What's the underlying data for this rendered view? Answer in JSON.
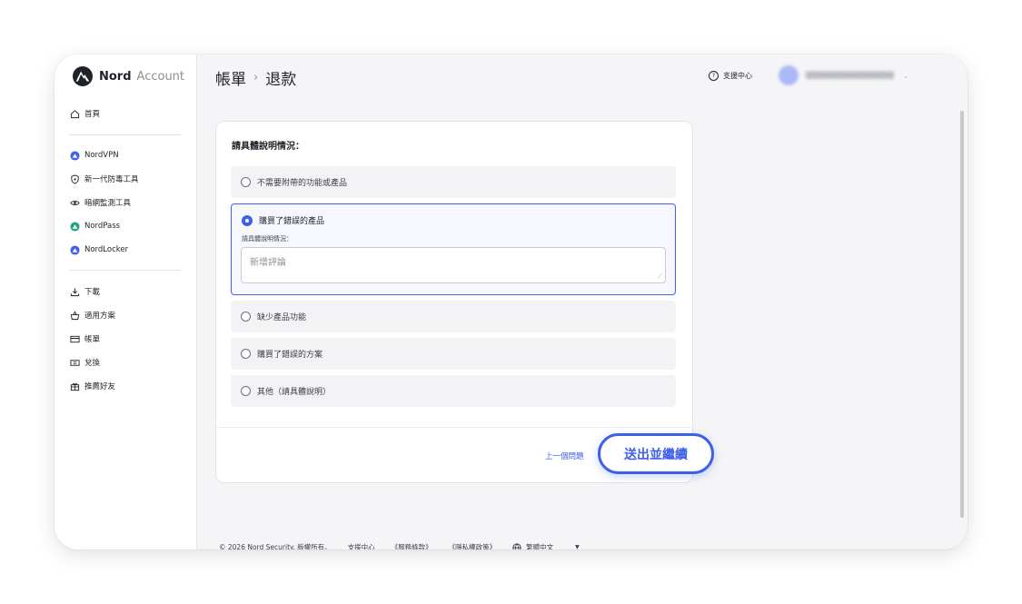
{
  "app": {
    "brand": "Nord",
    "product": "Account"
  },
  "sidebar": {
    "home": "首頁",
    "products": [
      {
        "label": "NordVPN",
        "icon": "nordvpn-icon",
        "color": "#4361ee"
      },
      {
        "label": "新一代防毒工具",
        "icon": "shield-icon"
      },
      {
        "label": "暗網監測工具",
        "icon": "eye-icon"
      },
      {
        "label": "NordPass",
        "icon": "nordpass-icon",
        "color": "#27a38a"
      },
      {
        "label": "NordLocker",
        "icon": "nordlocker-icon",
        "color": "#4361ee"
      }
    ],
    "account": [
      {
        "label": "下載",
        "icon": "download-icon"
      },
      {
        "label": "適用方案",
        "icon": "basket-icon"
      },
      {
        "label": "帳單",
        "icon": "card-icon"
      },
      {
        "label": "兌換",
        "icon": "ticket-icon"
      },
      {
        "label": "推薦好友",
        "icon": "gift-icon"
      }
    ]
  },
  "header": {
    "breadcrumb": [
      "帳單",
      "退款"
    ],
    "breadcrumb_separator": "›",
    "support": "支援中心"
  },
  "form": {
    "question": "請具體說明情況：",
    "options": [
      {
        "label": "不需要附帶的功能或產品",
        "selected": false
      },
      {
        "label": "購買了錯誤的產品",
        "selected": true
      },
      {
        "label": "缺少產品功能",
        "selected": false
      },
      {
        "label": "購買了錯誤的方案",
        "selected": false
      },
      {
        "label": "其他（請具體說明）",
        "selected": false
      }
    ],
    "detail_label": "請具體說明情況：",
    "detail_placeholder": "新增評論",
    "previous_label": "上一個問題",
    "submit_label": "送出並繼續"
  },
  "footer": {
    "copyright": "© 2026 Nord Security. 版權所有。",
    "links": [
      "支援中心",
      "《服務條款》",
      "《隱私權政策》"
    ],
    "language": "繁體中文"
  },
  "colors": {
    "accent": "#3e5fe9",
    "selected_border": "#4361ee"
  }
}
